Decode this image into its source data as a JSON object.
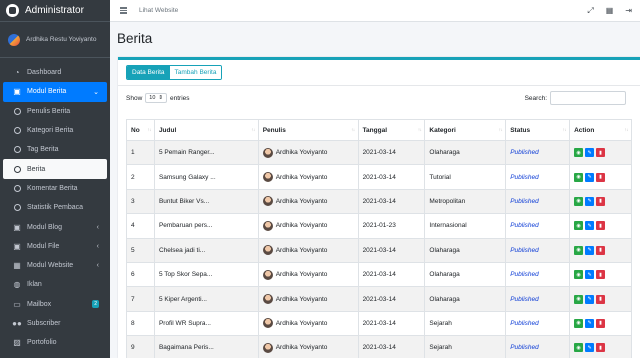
{
  "brand": {
    "title": "Administrator"
  },
  "user": {
    "name": "Ardhika Restu Yoviyanto"
  },
  "sidebar": {
    "items": [
      {
        "label": "Dashboard",
        "icon": "tachometer-icon"
      },
      {
        "label": "Modul Berita",
        "icon": "book-icon"
      },
      {
        "label": "Penulis Berita",
        "icon": "circle-icon"
      },
      {
        "label": "Kategori Berita",
        "icon": "circle-icon"
      },
      {
        "label": "Tag Berita",
        "icon": "circle-icon"
      },
      {
        "label": "Berita",
        "icon": "circle-icon"
      },
      {
        "label": "Komentar Berita",
        "icon": "circle-icon"
      },
      {
        "label": "Statistik Pembaca",
        "icon": "circle-icon"
      },
      {
        "label": "Modul Blog",
        "icon": "book-icon"
      },
      {
        "label": "Modul File",
        "icon": "book-icon"
      },
      {
        "label": "Modul Website",
        "icon": "table-icon"
      },
      {
        "label": "Iklan",
        "icon": "globe-icon"
      },
      {
        "label": "Mailbox",
        "icon": "inbox-icon",
        "badge": "2"
      },
      {
        "label": "Subscriber",
        "icon": "users-icon"
      },
      {
        "label": "Portofolio",
        "icon": "image-icon"
      }
    ]
  },
  "topbar": {
    "link": "Lihat Website"
  },
  "page": {
    "title": "Berita"
  },
  "tabs": {
    "data": "Data Berita",
    "add": "Tambah Berita"
  },
  "controls": {
    "show": "Show",
    "entries_value": "10",
    "entries": "entries",
    "search": "Search:"
  },
  "table": {
    "headers": [
      "No",
      "Judul",
      "Penulis",
      "Tanggal",
      "Kategori",
      "Status",
      "Action"
    ],
    "rows": [
      [
        "1",
        "5 Pemain Ranger...",
        "Ardhika Yoviyanto",
        "2021-03-14",
        "Olaharaga",
        "Published"
      ],
      [
        "2",
        "Samsung Galaxy ...",
        "Ardhika Yoviyanto",
        "2021-03-14",
        "Tutorial",
        "Published"
      ],
      [
        "3",
        "Buntut Biker Vs...",
        "Ardhika Yoviyanto",
        "2021-03-14",
        "Metropolitan",
        "Published"
      ],
      [
        "4",
        "Pembaruan pers...",
        "Ardhika Yoviyanto",
        "2021-01-23",
        "Internasional",
        "Published"
      ],
      [
        "5",
        "Chelsea jadi ti...",
        "Ardhika Yoviyanto",
        "2021-03-14",
        "Olaharaga",
        "Published"
      ],
      [
        "6",
        "5 Top Skor Sepa...",
        "Ardhika Yoviyanto",
        "2021-03-14",
        "Olaharaga",
        "Published"
      ],
      [
        "7",
        "5 Kiper Argenti...",
        "Ardhika Yoviyanto",
        "2021-03-14",
        "Olaharaga",
        "Published"
      ],
      [
        "8",
        "Profil WR Supra...",
        "Ardhika Yoviyanto",
        "2021-03-14",
        "Sejarah",
        "Published"
      ],
      [
        "9",
        "Bagaimana Peris...",
        "Ardhika Yoviyanto",
        "2021-03-14",
        "Sejarah",
        "Published"
      ]
    ]
  },
  "colors": {
    "sidebar": "#343a40",
    "accent": "#007bff",
    "info": "#17a2b8",
    "status": "#0d3cd6"
  }
}
